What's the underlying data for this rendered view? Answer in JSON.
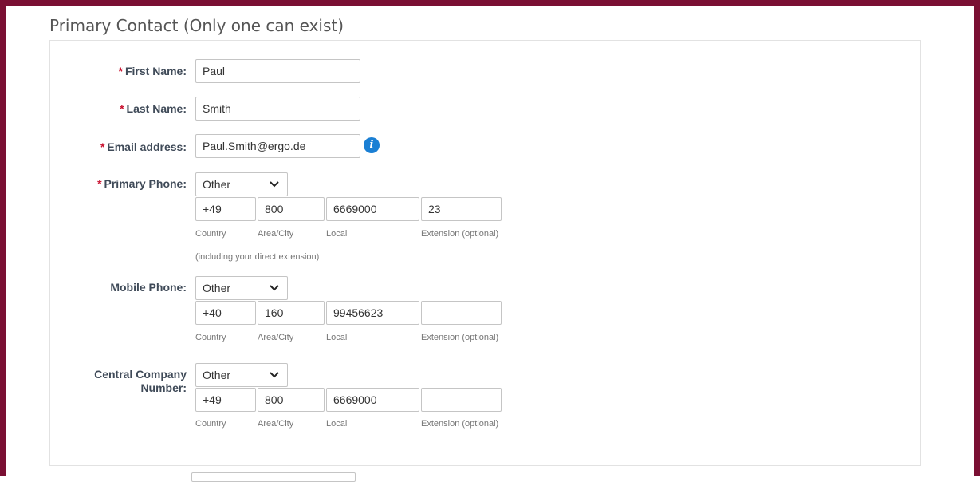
{
  "section_title": "Primary Contact (Only one can exist)",
  "required_marker": "*",
  "fields": {
    "first_name": {
      "label": "First Name:",
      "value": "Paul"
    },
    "last_name": {
      "label": "Last Name:",
      "value": "Smith"
    },
    "email": {
      "label": "Email address:",
      "value": "Paul.Smith@ergo.de",
      "info_icon": "info-icon"
    }
  },
  "phone_sublabels": {
    "country": "Country",
    "area": "Area/City",
    "local": "Local",
    "extension": "Extension (optional)"
  },
  "primary_phone": {
    "label": "Primary Phone:",
    "type": "Other",
    "country": "+49",
    "area": "800",
    "local": "6669000",
    "extension": "23",
    "note": "(including your direct extension)"
  },
  "mobile_phone": {
    "label": "Mobile Phone:",
    "type": "Other",
    "country": "+40",
    "area": "160",
    "local": "99456623",
    "extension": ""
  },
  "central_number": {
    "label_line1": "Central Company",
    "label_line2": "Number:",
    "type": "Other",
    "country": "+49",
    "area": "800",
    "local": "6669000",
    "extension": ""
  },
  "colors": {
    "frame": "#7a0f33",
    "required": "#c8102e",
    "info": "#1a7fd4",
    "label": "#3f4a58"
  }
}
